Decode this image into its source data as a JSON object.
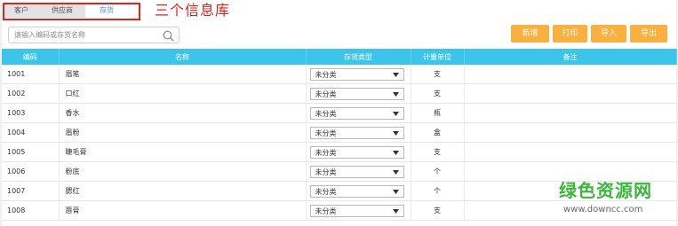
{
  "tabs": [
    {
      "label": "客户"
    },
    {
      "label": "供应商"
    },
    {
      "label": "存货"
    }
  ],
  "active_tab": "存货",
  "annotation": "三个信息库",
  "search": {
    "placeholder": "请输入编码或存货名称",
    "value": ""
  },
  "actions": {
    "new": "新增",
    "print": "打印",
    "import": "导入",
    "export": "导出"
  },
  "table": {
    "headers": {
      "code": "编码",
      "name": "名称",
      "type": "存货类型",
      "unit": "计量单位",
      "remark": "备注"
    },
    "rows": [
      {
        "code": "1001",
        "name": "眉笔",
        "type": "未分类",
        "unit": "支",
        "remark": ""
      },
      {
        "code": "1002",
        "name": "口红",
        "type": "未分类",
        "unit": "支",
        "remark": ""
      },
      {
        "code": "1003",
        "name": "香水",
        "type": "未分类",
        "unit": "瓶",
        "remark": ""
      },
      {
        "code": "1004",
        "name": "眉粉",
        "type": "未分类",
        "unit": "盒",
        "remark": ""
      },
      {
        "code": "1005",
        "name": "睫毛膏",
        "type": "未分类",
        "unit": "支",
        "remark": ""
      },
      {
        "code": "1006",
        "name": "粉底",
        "type": "未分类",
        "unit": "个",
        "remark": ""
      },
      {
        "code": "1007",
        "name": "腮红",
        "type": "未分类",
        "unit": "个",
        "remark": ""
      },
      {
        "code": "1008",
        "name": "唇膏",
        "type": "未分类",
        "unit": "支",
        "remark": ""
      }
    ]
  },
  "watermark": {
    "title": "绿色资源网",
    "url": "www.downcc.com"
  },
  "colors": {
    "header_bg": "#3cc4ea",
    "button_bg": "#f9b03e",
    "annotation_red": "#e2221b",
    "active_tab_text": "#3a9ce8",
    "watermark_green": "#3bb53b"
  },
  "icons": {
    "search": "search-icon",
    "dropdown": "caret-down-icon"
  }
}
